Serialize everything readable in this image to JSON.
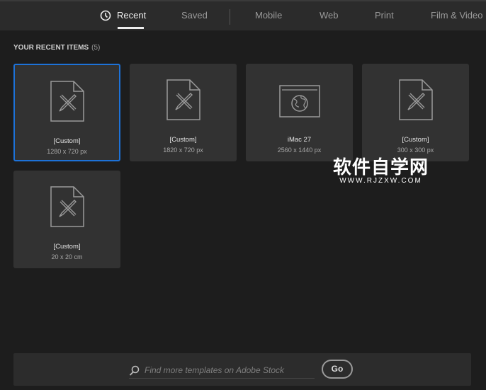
{
  "header": {
    "tabs": [
      {
        "label": "Recent",
        "active": true,
        "icon": "clock-icon"
      },
      {
        "label": "Saved"
      },
      {
        "label": "Mobile"
      },
      {
        "label": "Web"
      },
      {
        "label": "Print"
      },
      {
        "label": "Film & Video"
      }
    ]
  },
  "section": {
    "title": "YOUR RECENT ITEMS",
    "count": "(5)"
  },
  "items": [
    {
      "name": "[Custom]",
      "size": "1280 x 720 px",
      "icon": "custom-document-icon",
      "selected": true
    },
    {
      "name": "[Custom]",
      "size": "1820 x 720 px",
      "icon": "custom-document-icon"
    },
    {
      "name": "iMac 27",
      "size": "2560 x 1440 px",
      "icon": "web-browser-icon"
    },
    {
      "name": "[Custom]",
      "size": "300 x 300 px",
      "icon": "custom-document-icon"
    },
    {
      "name": "[Custom]",
      "size": "20 x 20 cm",
      "icon": "custom-document-icon"
    }
  ],
  "footer": {
    "search_placeholder": "Find more templates on Adobe Stock",
    "go_label": "Go"
  },
  "watermark": {
    "title": "软件自学网",
    "url": "WWW.RJZXW.COM"
  },
  "colors": {
    "accent": "#1d72d8",
    "header": "#2b2b2b",
    "background": "#1d1d1d",
    "card": "#323232"
  }
}
